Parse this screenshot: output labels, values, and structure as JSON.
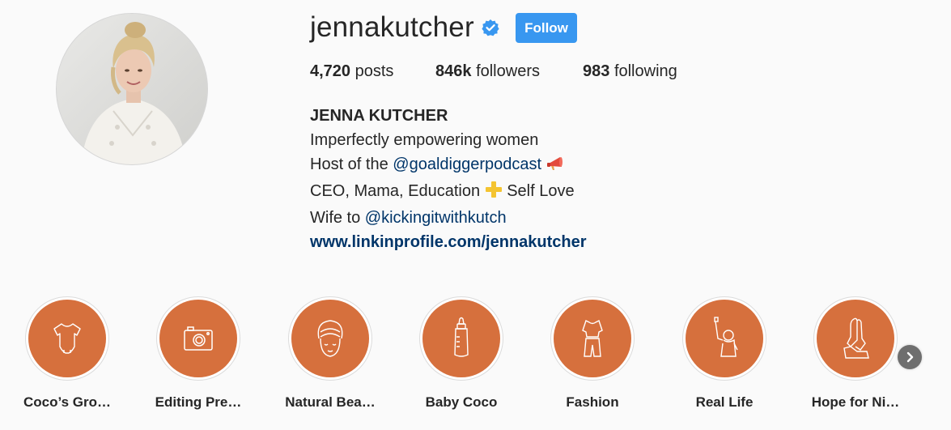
{
  "profile": {
    "username": "jennakutcher",
    "verified_icon": "verified-badge-icon",
    "follow_label": "Follow",
    "accent_color": "#3897f0"
  },
  "stats": {
    "posts_count": "4,720",
    "posts_label": "posts",
    "followers_count": "846k",
    "followers_label": "followers",
    "following_count": "983",
    "following_label": "following"
  },
  "bio": {
    "full_name": "JENNA KUTCHER",
    "line1": "Imperfectly empowering women",
    "line2_prefix": "Host of the ",
    "line2_mention": "@goaldiggerpodcast",
    "line2_emoji": "megaphone-icon",
    "line3_prefix": "CEO, Mama, Education ",
    "line3_emoji": "plus-icon",
    "line3_suffix": " Self Love",
    "line4_prefix": "Wife to ",
    "line4_mention": "@kickingitwithkutch",
    "website": "www.linkinprofile.com/jennakutcher"
  },
  "highlights": {
    "color": "#d6703d",
    "items": [
      {
        "label": "Coco’s Gro…",
        "icon": "onesie-icon"
      },
      {
        "label": "Editing Pre…",
        "icon": "camera-icon"
      },
      {
        "label": "Natural Bea…",
        "icon": "face-towel-icon"
      },
      {
        "label": "Baby Coco",
        "icon": "baby-bottle-icon"
      },
      {
        "label": "Fashion",
        "icon": "outfit-icon"
      },
      {
        "label": "Real Life",
        "icon": "person-raising-hand-icon"
      },
      {
        "label": "Hope for Ni…",
        "icon": "praying-hands-icon"
      }
    ],
    "next_icon": "chevron-right-icon"
  }
}
